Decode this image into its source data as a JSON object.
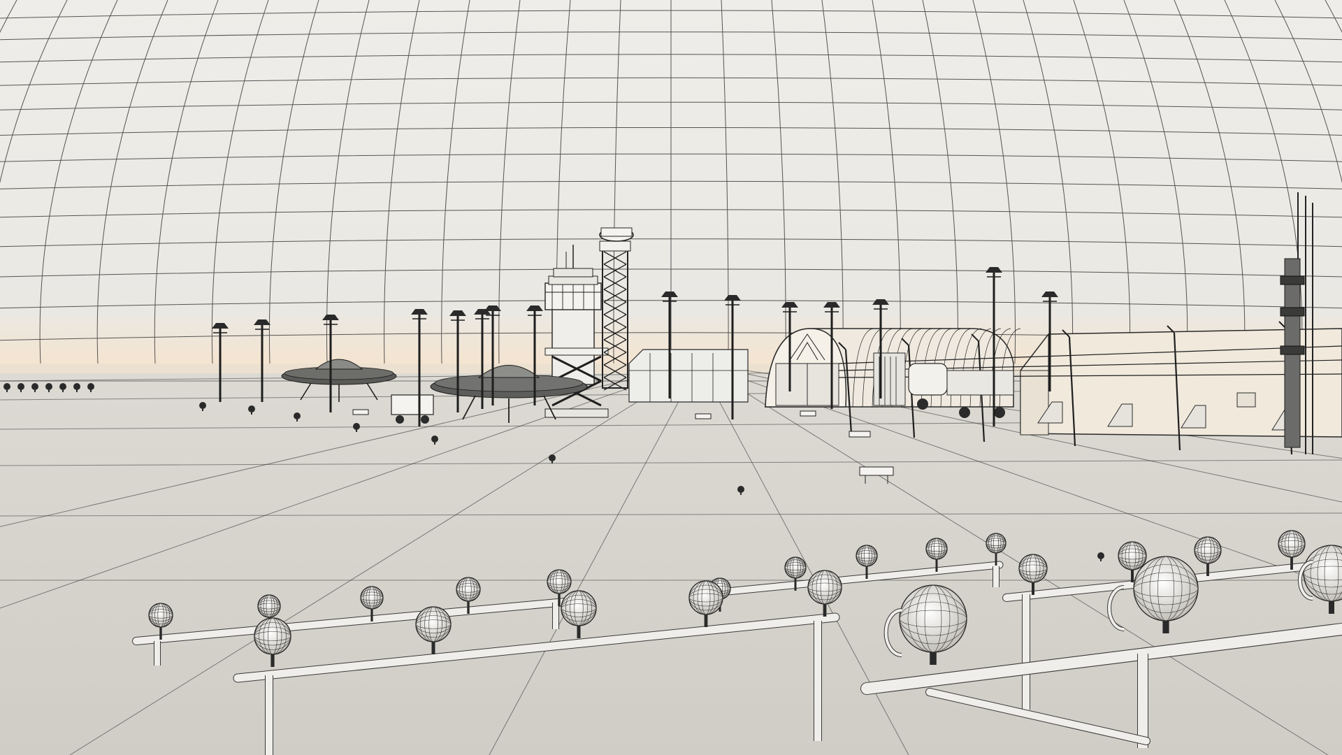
{
  "scene": {
    "subject": "wireframe-render-airfield",
    "elements": {
      "sky_dome": "lat-long-grid",
      "ground": "tarmac-plane",
      "saucers": 2,
      "control_tower": 1,
      "radar_tower": 1,
      "quonset_hangar": 1,
      "warehouse": 1,
      "light_poles": "many",
      "approach_light_bars": "foreground"
    },
    "colors": {
      "sky": "#ebeae7",
      "horizon_glow": "#f6e6d2",
      "ground": "#d8d6cf",
      "ground_near": "#cfcdc5",
      "line": "#1c1c1c",
      "metal_light": "#f3f2ee",
      "hangar_fill": "#efe9df",
      "warehouse_fill": "#f0e9dc"
    }
  }
}
